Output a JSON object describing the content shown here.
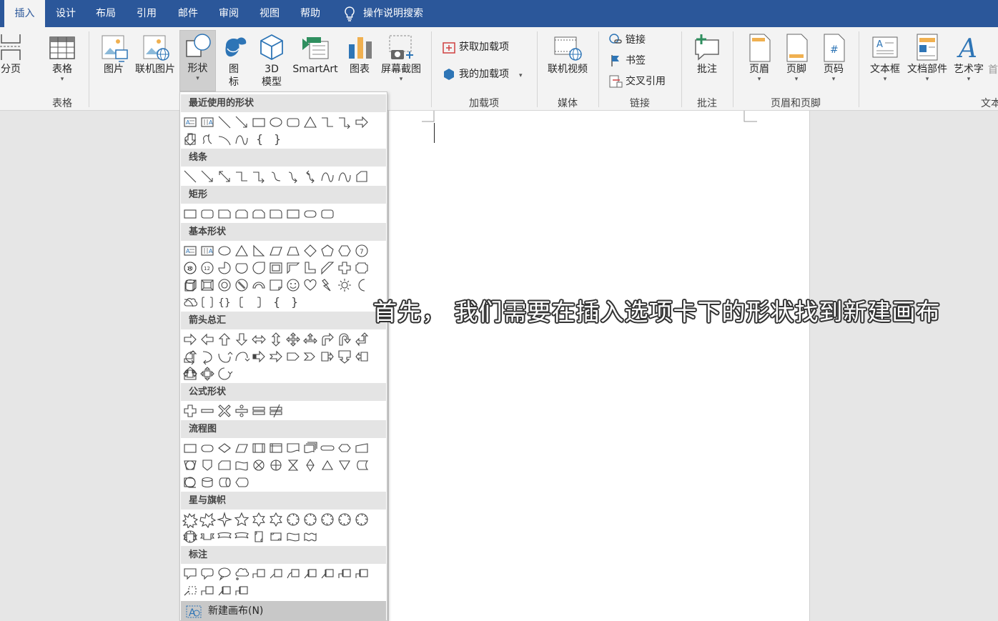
{
  "tabs": [
    {
      "label": "插入",
      "active": true
    },
    {
      "label": "设计"
    },
    {
      "label": "布局"
    },
    {
      "label": "引用"
    },
    {
      "label": "邮件"
    },
    {
      "label": "审阅"
    },
    {
      "label": "视图"
    },
    {
      "label": "帮助"
    }
  ],
  "tell_me": "操作说明搜索",
  "ribbon": {
    "page_break": "分页",
    "table": "表格",
    "group_table": "表格",
    "picture": "图片",
    "online_picture": "联机图片",
    "shapes": "形状",
    "icons": "图\n标",
    "model3d": "3D\n模型",
    "smartart": "SmartArt",
    "chart": "图表",
    "screenshot": "屏幕截图",
    "get_addins": "获取加载项",
    "my_addins": "我的加载项",
    "group_addins": "加载项",
    "online_video": "联机视频",
    "group_media": "媒体",
    "link": "链接",
    "bookmark": "书签",
    "cross_ref": "交叉引用",
    "group_links": "链接",
    "comment": "批注",
    "group_comments": "批注",
    "header": "页眉",
    "footer": "页脚",
    "page_number": "页码",
    "group_header_footer": "页眉和页脚",
    "textbox": "文本框",
    "quick_parts": "文档部件",
    "wordart": "艺术字",
    "group_text": "文本",
    "cut_char": "首"
  },
  "dropdown": {
    "sections": [
      "最近使用的形状",
      "线条",
      "矩形",
      "基本形状",
      "箭头总汇",
      "公式形状",
      "流程图",
      "星与旗帜",
      "标注"
    ],
    "new_canvas": "新建画布(N)"
  },
  "subtitle": "首先， 我们需要在插入选项卡下的形状找到新建画布",
  "colors": {
    "tabbar": "#2b579a",
    "ribbon": "#f3f3f3",
    "accent_blue": "#2e75b6"
  }
}
